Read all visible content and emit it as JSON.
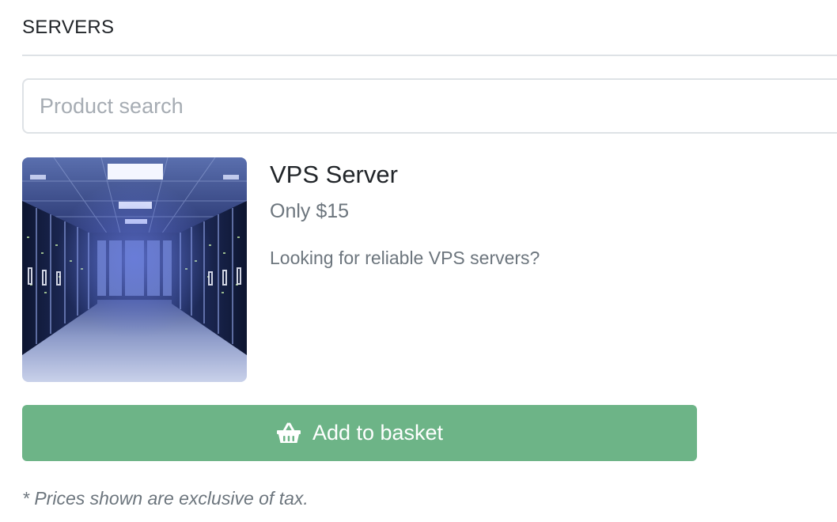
{
  "section": {
    "title": "SERVERS"
  },
  "search": {
    "placeholder": "Product search",
    "value": ""
  },
  "product": {
    "name": "VPS Server",
    "price": "Only $15",
    "description": "Looking for reliable VPS servers?",
    "image_icon": "server-room-photo"
  },
  "basket_button": {
    "label": "Add to basket",
    "icon": "basket-icon",
    "color": "#6db487"
  },
  "footer": {
    "tax_note": "* Prices shown are exclusive of tax."
  },
  "colors": {
    "text_dark": "#212529",
    "text_muted": "#6c757d",
    "border": "#dee2e6"
  }
}
